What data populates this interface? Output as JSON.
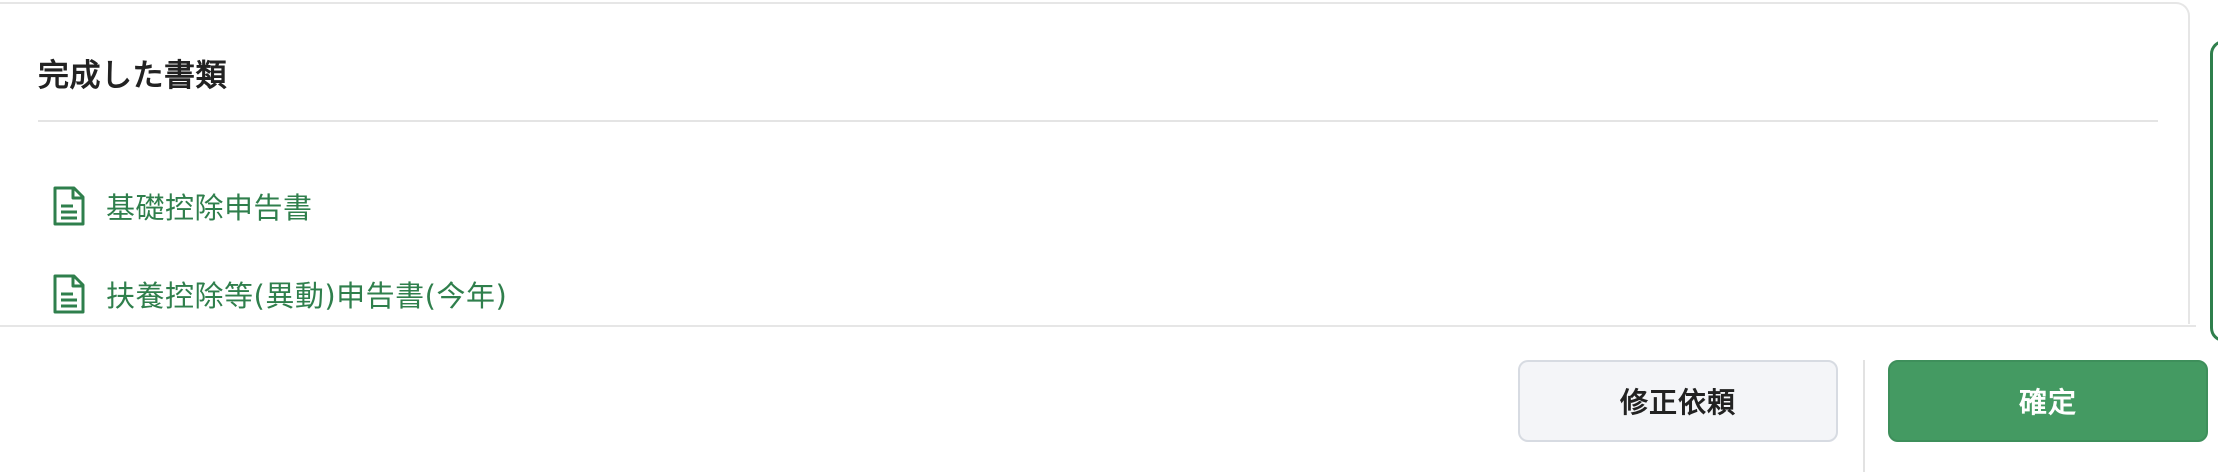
{
  "section": {
    "title": "完成した書類"
  },
  "documents": [
    {
      "label": "基礎控除申告書",
      "icon": "document-icon"
    },
    {
      "label": "扶養控除等(異動)申告書(今年)",
      "icon": "document-icon"
    }
  ],
  "footer": {
    "request_fix_label": "修正依頼",
    "confirm_label": "確定"
  },
  "colors": {
    "accent_green": "#449a62",
    "link_green": "#2f7f4c",
    "secondary_bg": "#f4f5f8"
  }
}
